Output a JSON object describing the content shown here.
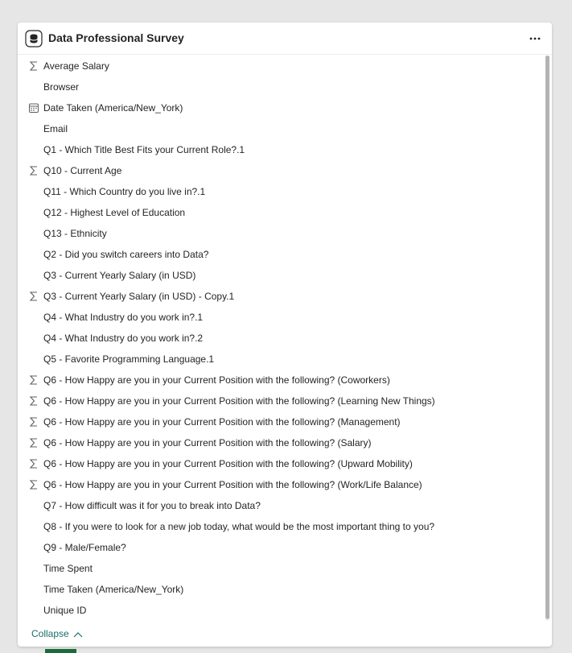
{
  "header": {
    "title": "Data Professional Survey",
    "table_icon": "table-icon",
    "more_icon": "more-options-icon"
  },
  "fields": [
    {
      "label": "Average Salary",
      "icon": "sigma-icon"
    },
    {
      "label": "Browser",
      "icon": ""
    },
    {
      "label": "Date Taken (America/New_York)",
      "icon": "calendar-icon"
    },
    {
      "label": "Email",
      "icon": ""
    },
    {
      "label": "Q1 - Which Title Best Fits your Current Role?.1",
      "icon": ""
    },
    {
      "label": "Q10 - Current Age",
      "icon": "sigma-icon"
    },
    {
      "label": "Q11 - Which Country do you live in?.1",
      "icon": ""
    },
    {
      "label": "Q12 - Highest Level of Education",
      "icon": ""
    },
    {
      "label": "Q13 - Ethnicity",
      "icon": ""
    },
    {
      "label": "Q2 - Did you switch careers into Data?",
      "icon": ""
    },
    {
      "label": "Q3 - Current Yearly Salary (in USD)",
      "icon": ""
    },
    {
      "label": "Q3 - Current Yearly Salary (in USD) - Copy.1",
      "icon": "sigma-icon"
    },
    {
      "label": "Q4 - What Industry do you work in?.1",
      "icon": ""
    },
    {
      "label": "Q4 - What Industry do you work in?.2",
      "icon": ""
    },
    {
      "label": "Q5 - Favorite Programming Language.1",
      "icon": ""
    },
    {
      "label": "Q6 - How Happy are you in your Current Position with the following? (Coworkers)",
      "icon": "sigma-icon"
    },
    {
      "label": "Q6 - How Happy are you in your Current Position with the following? (Learning New Things)",
      "icon": "sigma-icon"
    },
    {
      "label": "Q6 - How Happy are you in your Current Position with the following? (Management)",
      "icon": "sigma-icon"
    },
    {
      "label": "Q6 - How Happy are you in your Current Position with the following? (Salary)",
      "icon": "sigma-icon"
    },
    {
      "label": "Q6 - How Happy are you in your Current Position with the following? (Upward Mobility)",
      "icon": "sigma-icon"
    },
    {
      "label": "Q6 - How Happy are you in your Current Position with the following? (Work/Life Balance)",
      "icon": "sigma-icon"
    },
    {
      "label": "Q7 - How difficult was it for you to break into Data?",
      "icon": ""
    },
    {
      "label": "Q8 - If you were to look for a new job today, what would be the most important thing to you?",
      "icon": ""
    },
    {
      "label": "Q9 - Male/Female?",
      "icon": ""
    },
    {
      "label": "Time Spent",
      "icon": ""
    },
    {
      "label": "Time Taken (America/New_York)",
      "icon": ""
    },
    {
      "label": "Unique ID",
      "icon": ""
    }
  ],
  "footer": {
    "collapse_label": "Collapse",
    "collapse_icon": "chevron-up-icon"
  },
  "colors": {
    "accent": "#1b6e6a",
    "text": "#252423",
    "icon": "#605e5c"
  }
}
